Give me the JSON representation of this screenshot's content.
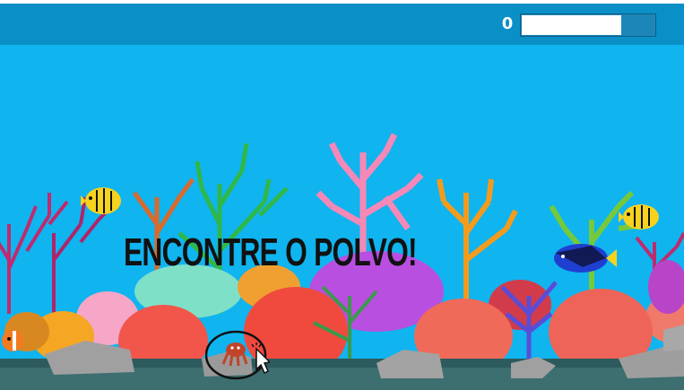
{
  "game": {
    "score": "0",
    "timer_fraction": 0.75,
    "prompt": "ENCONTRE O POLVO!"
  },
  "colors": {
    "hud_bar": "#0a8fc6",
    "water": "#10b4ef",
    "target_marker": "#111111",
    "hidden_creature": "#c1442a"
  },
  "icons": {
    "cursor": "pointer-cursor-icon",
    "hidden_creature": "octopus-icon"
  }
}
